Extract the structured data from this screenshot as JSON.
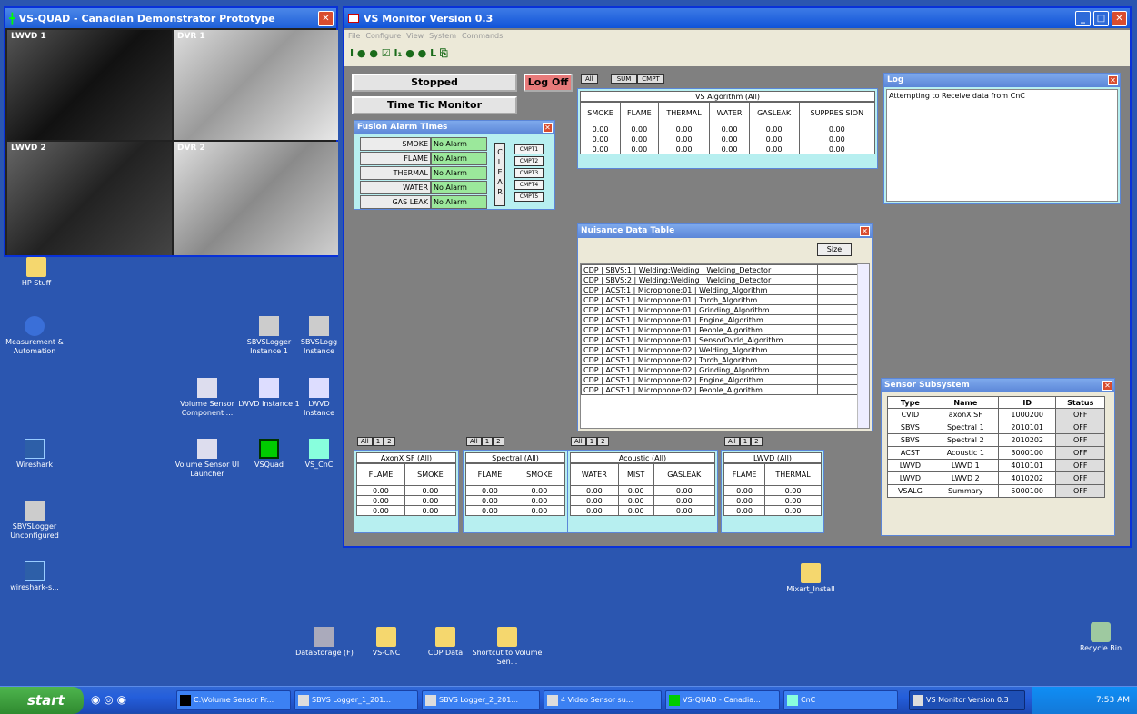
{
  "quad": {
    "title": "VS-QUAD - Canadian Demonstrator Prototype",
    "cams": [
      "LWVD 1",
      "DVR 1",
      "LWVD 2",
      "DVR 2"
    ]
  },
  "monitor": {
    "title": "VS Monitor Version 0.3",
    "menu": [
      "File",
      "Configure",
      "View",
      "System",
      "Commands"
    ],
    "toolbar": "I ● ● ☑ I₁ ● ● L ⎘"
  },
  "controls": {
    "stopped": "Stopped",
    "logoff": "Log Off",
    "timetic": "Time Tic Monitor"
  },
  "fusion": {
    "title": "Fusion Alarm Times",
    "rows": [
      {
        "label": "SMOKE",
        "value": "No Alarm"
      },
      {
        "label": "FLAME",
        "value": "No Alarm"
      },
      {
        "label": "THERMAL",
        "value": "No Alarm"
      },
      {
        "label": "WATER",
        "value": "No Alarm"
      },
      {
        "label": "GAS LEAK",
        "value": "No Alarm"
      }
    ],
    "clear": [
      "C",
      "L",
      "E",
      "A",
      "R"
    ],
    "cmpt": [
      "CMPT1",
      "CMPT2",
      "CMPT3",
      "CMPT4",
      "CMPT5"
    ]
  },
  "vsalg": {
    "tabs": [
      "All",
      "SUM",
      "CMPT"
    ],
    "title": "VS Algorithm (All)",
    "headers": [
      "SMOKE",
      "FLAME",
      "THERMAL",
      "WATER",
      "GASLEAK",
      "SUPPRES SION"
    ],
    "rows": [
      [
        "0.00",
        "0.00",
        "0.00",
        "0.00",
        "0.00",
        "0.00"
      ],
      [
        "0.00",
        "0.00",
        "0.00",
        "0.00",
        "0.00",
        "0.00"
      ],
      [
        "0.00",
        "0.00",
        "0.00",
        "0.00",
        "0.00",
        "0.00"
      ]
    ]
  },
  "log": {
    "title": "Log",
    "text": "Attempting to Receive data from CnC"
  },
  "nuisance": {
    "title": "Nuisance Data Table",
    "size": "Size",
    "rows": [
      "CDP | SBVS:1 | Welding:Welding | Welding_Detector",
      "CDP | SBVS:2 | Welding:Welding | Welding_Detector",
      "CDP | ACST:1 | Microphone:01 | Welding_Algorithm",
      "CDP | ACST:1 | Microphone:01 | Torch_Algorithm",
      "CDP | ACST:1 | Microphone:01 | Grinding_Algorithm",
      "CDP | ACST:1 | Microphone:01 | Engine_Algorithm",
      "CDP | ACST:1 | Microphone:01 | People_Algorithm",
      "CDP | ACST:1 | Microphone:01 | SensorOvrld_Algorithm",
      "CDP | ACST:1 | Microphone:02 | Welding_Algorithm",
      "CDP | ACST:1 | Microphone:02 | Torch_Algorithm",
      "CDP | ACST:1 | Microphone:02 | Grinding_Algorithm",
      "CDP | ACST:1 | Microphone:02 | Engine_Algorithm",
      "CDP | ACST:1 | Microphone:02 | People_Algorithm"
    ]
  },
  "sensor": {
    "title": "Sensor Subsystem",
    "headers": [
      "Type",
      "Name",
      "ID",
      "Status"
    ],
    "rows": [
      [
        "CVID",
        "axonX SF",
        "1000200",
        "OFF"
      ],
      [
        "SBVS",
        "Spectral 1",
        "2010101",
        "OFF"
      ],
      [
        "SBVS",
        "Spectral 2",
        "2010202",
        "OFF"
      ],
      [
        "ACST",
        "Acoustic 1",
        "3000100",
        "OFF"
      ],
      [
        "LWVD",
        "LWVD 1",
        "4010101",
        "OFF"
      ],
      [
        "LWVD",
        "LWVD 2",
        "4010202",
        "OFF"
      ],
      [
        "VSALG",
        "Summary",
        "5000100",
        "OFF"
      ]
    ]
  },
  "groups": [
    {
      "tabs": [
        "All",
        "1",
        "2"
      ],
      "title": "AxonX SF (All)",
      "headers": [
        "FLAME",
        "SMOKE"
      ],
      "rows": [
        [
          "0.00",
          "0.00"
        ],
        [
          "0.00",
          "0.00"
        ],
        [
          "0.00",
          "0.00"
        ]
      ]
    },
    {
      "tabs": [
        "All",
        "1",
        "2"
      ],
      "title": "Spectral (All)",
      "headers": [
        "FLAME",
        "SMOKE"
      ],
      "rows": [
        [
          "0.00",
          "0.00"
        ],
        [
          "0.00",
          "0.00"
        ],
        [
          "0.00",
          "0.00"
        ]
      ]
    },
    {
      "tabs": [
        "All",
        "1",
        "2"
      ],
      "title": "Acoustic (All)",
      "headers": [
        "WATER",
        "MIST",
        "GASLEAK"
      ],
      "rows": [
        [
          "0.00",
          "0.00",
          "0.00"
        ],
        [
          "0.00",
          "0.00",
          "0.00"
        ],
        [
          "0.00",
          "0.00",
          "0.00"
        ]
      ]
    },
    {
      "tabs": [
        "All",
        "1",
        "2"
      ],
      "title": "LWVD (All)",
      "headers": [
        "FLAME",
        "THERMAL"
      ],
      "rows": [
        [
          "0.00",
          "0.00"
        ],
        [
          "0.00",
          "0.00"
        ],
        [
          "0.00",
          "0.00"
        ]
      ]
    }
  ],
  "icons": {
    "hp": "HP Stuff",
    "meas": "Measurement & Automation",
    "sbvs1": "SBVSLogger Instance 1",
    "sbvs2": "SBVSLogg Instance",
    "vsc": "Volume Sensor Component ...",
    "lwvd1": "LWVD Instance 1",
    "lwvd2": "LWVD Instance",
    "wire": "Wireshark",
    "vsui": "Volume Sensor UI Launcher",
    "vsquad": "VSQuad",
    "vscnc": "VS_CnC",
    "sbvsu": "SBVSLogger Unconfigured",
    "wire2": "wireshark-s...",
    "mixart": "Mixart_Install",
    "ds": "DataStorage (F)",
    "vscnc2": "VS-CNC",
    "cdp": "CDP Data",
    "short": "Shortcut to Volume Sen...",
    "recycle": "Recycle Bin"
  },
  "taskbar": {
    "start": "start",
    "items": [
      "C:\\Volume Sensor Pr...",
      "SBVS Logger_1_201...",
      "SBVS Logger_2_201...",
      "4 Video Sensor su...",
      "VS-QUAD - Canadia...",
      "CnC",
      "VS Monitor Version 0.3"
    ],
    "clock": "7:53 AM"
  }
}
